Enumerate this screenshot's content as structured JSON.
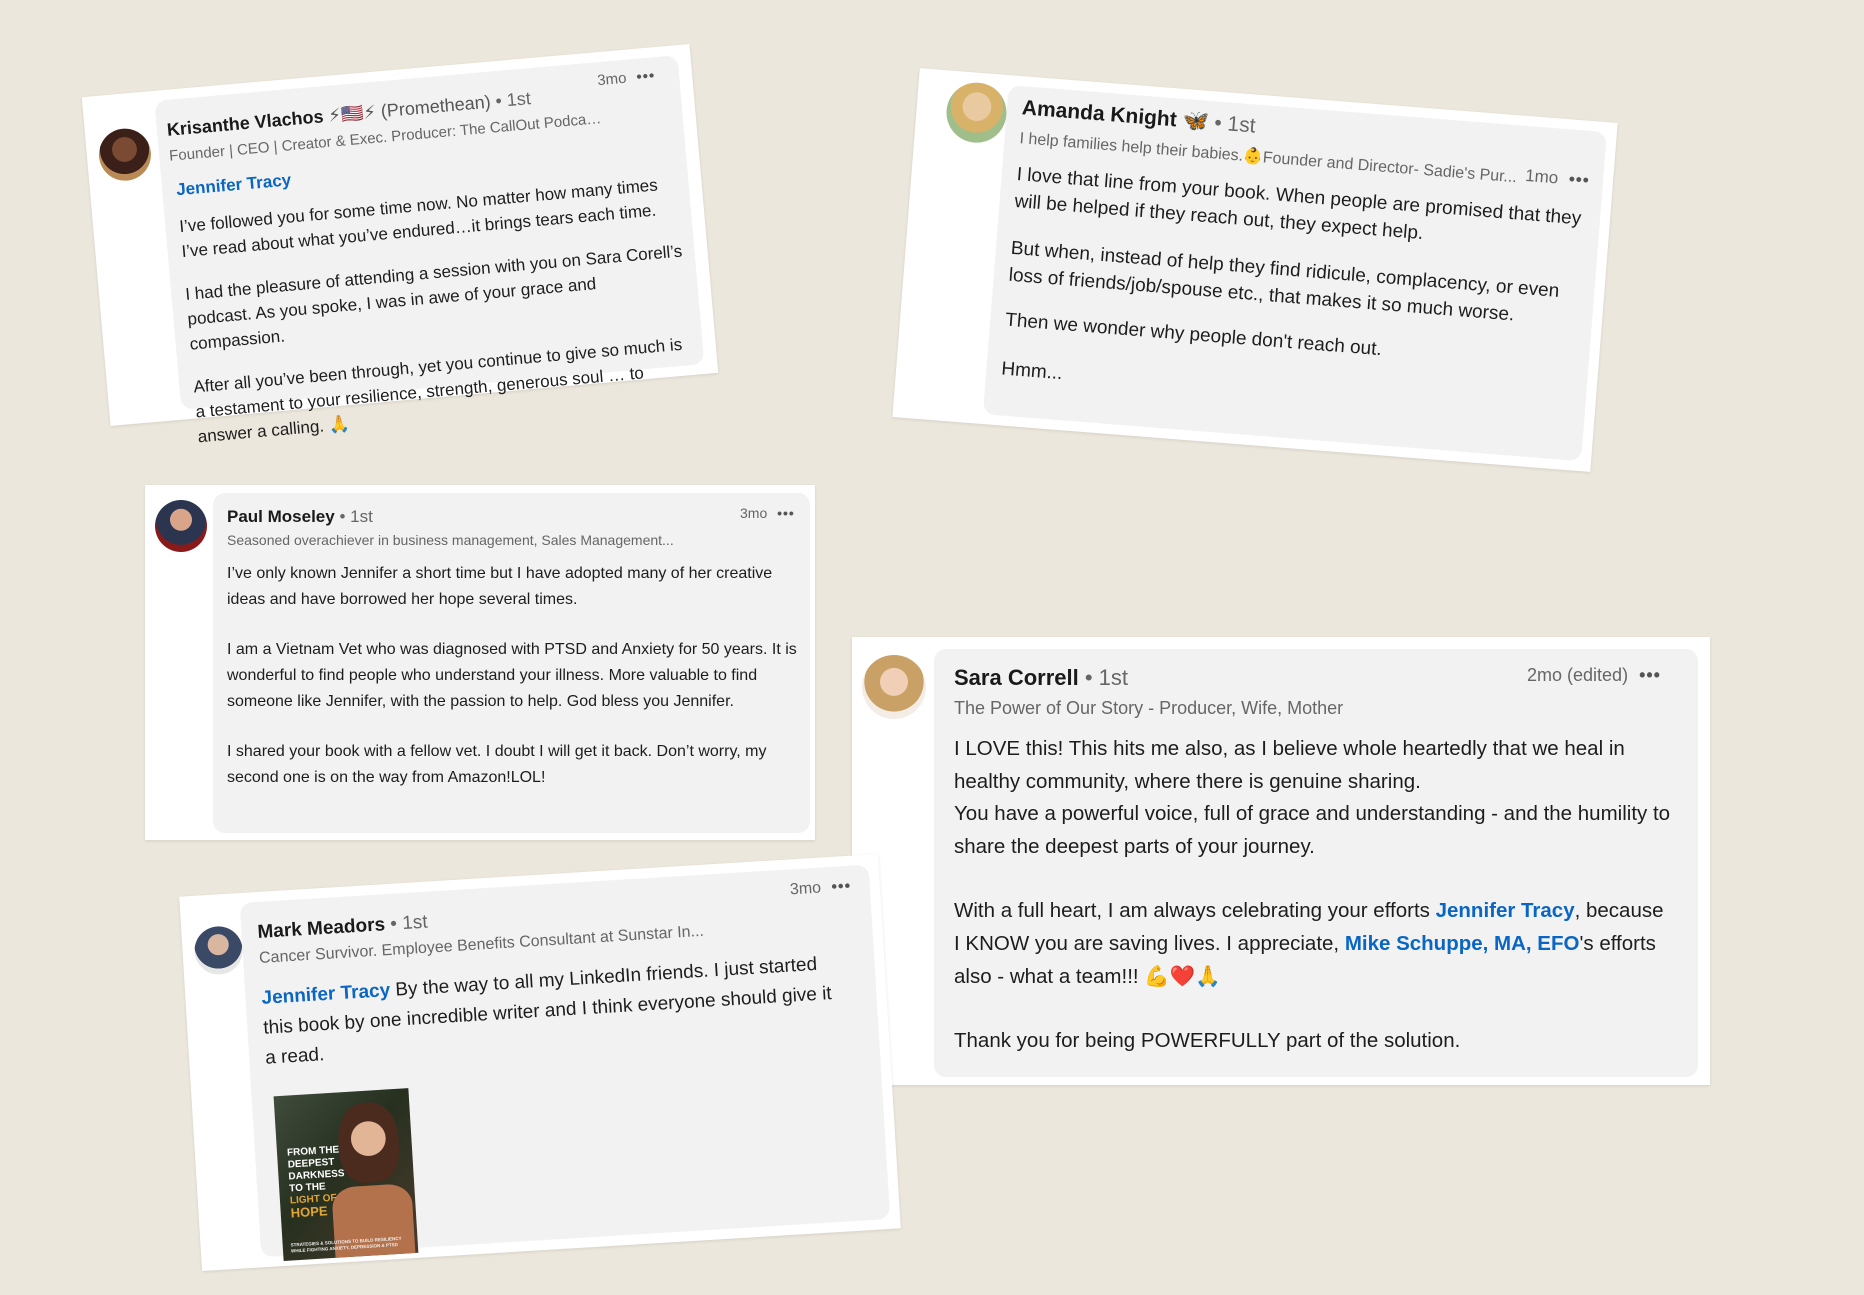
{
  "comments": {
    "krisanthe": {
      "name": "Krisanthe Vlachos",
      "name_suffix": " ⚡🇺🇸⚡ (Promethean)",
      "degree": "• 1st",
      "headline": "Founder | CEO | Creator & Exec. Producer: The CallOut Podcast | LIN...",
      "time": "3mo",
      "more": "•••",
      "mention": "Jennifer Tracy",
      "p1": "I’ve followed you for some time now. No matter how many times I’ve read about what you’ve endured…it brings tears each time.",
      "p2": "I had the pleasure of attending a session with you on Sara Corell’s podcast. As you spoke, I was in awe of your grace and compassion.",
      "p3": "After all you’ve been through, yet you continue to give so much is a testament to your resilience, strength, generous soul … to answer a calling. 🙏"
    },
    "amanda": {
      "name": "Amanda Knight",
      "name_suffix": " 🦋",
      "degree": "• 1st",
      "headline": "I help families help their babies.👶Founder and Director- Sadie's Pur...",
      "time": "1mo",
      "more": "•••",
      "p1": "I love that line from your book. When people are promised that they will be helped if they reach out, they expect help.",
      "p2": "But when, instead of help they find ridicule, complacency, or even loss of friends/job/spouse etc., that makes it so much worse.",
      "p3": "Then we wonder why people don't reach out.",
      "p4": "Hmm..."
    },
    "paul": {
      "name": "Paul Moseley",
      "degree": "• 1st",
      "headline": "Seasoned overachiever in business management, Sales Management...",
      "time": "3mo",
      "more": "•••",
      "p1": "I’ve only known Jennifer a short time but I have adopted many of her creative ideas and have borrowed her hope several times.",
      "p2": "I am a Vietnam Vet who was diagnosed with PTSD and Anxiety for 50 years. It is wonderful to find people who understand your illness. More valuable to find someone like Jennifer, with the passion to help. God bless you Jennifer.",
      "p3": "I shared your book with a fellow vet. I doubt I will get it back. Don’t worry, my second one is on the way from Amazon!LOL!"
    },
    "sara": {
      "name": "Sara Correll",
      "degree": "• 1st",
      "headline": "The Power of Our Story - Producer, Wife, Mother",
      "time": "2mo",
      "edited": "(edited)",
      "more": "•••",
      "p1": "I LOVE this! This hits me also, as I believe whole heartedly that we heal in healthy community, where there is genuine sharing.",
      "p2": "You have a powerful voice, full of grace and understanding - and the humility to share the deepest parts of your journey.",
      "p3a": "With a full heart, I am always celebrating your efforts ",
      "mention1": "Jennifer Tracy",
      "p3b": ", because I KNOW you are saving lives. I appreciate, ",
      "mention2": "Mike Schuppe, MA, EFO",
      "p3c": "'s efforts also - what a team!!! 💪❤️🙏",
      "p4": "Thank you for being POWERFULLY part of the solution."
    },
    "mark": {
      "name": "Mark Meadors",
      "degree": "• 1st",
      "headline": "Cancer Survivor. Employee Benefits Consultant at Sunstar In...",
      "time": "3mo",
      "more": "•••",
      "mention": "Jennifer Tracy",
      "text": " By the way to all my LinkedIn friends. I just started this book by one incredible writer and I think everyone should give it a read.",
      "book": {
        "title_lines": [
          "FROM THE",
          "DEEPEST",
          "DARKNESS",
          "TO THE"
        ],
        "hope_lines": [
          "LIGHT OF",
          "HOPE"
        ],
        "subtitle": "STRATEGIES & SOLUTIONS TO BUILD RESILIENCY WHILE FIGHTING ANXIETY, DEPRESSION & PTSD"
      }
    }
  },
  "colors": {
    "background": "#ece7dc",
    "bubble": "#f2f2f2",
    "mention": "#0a66c2"
  }
}
